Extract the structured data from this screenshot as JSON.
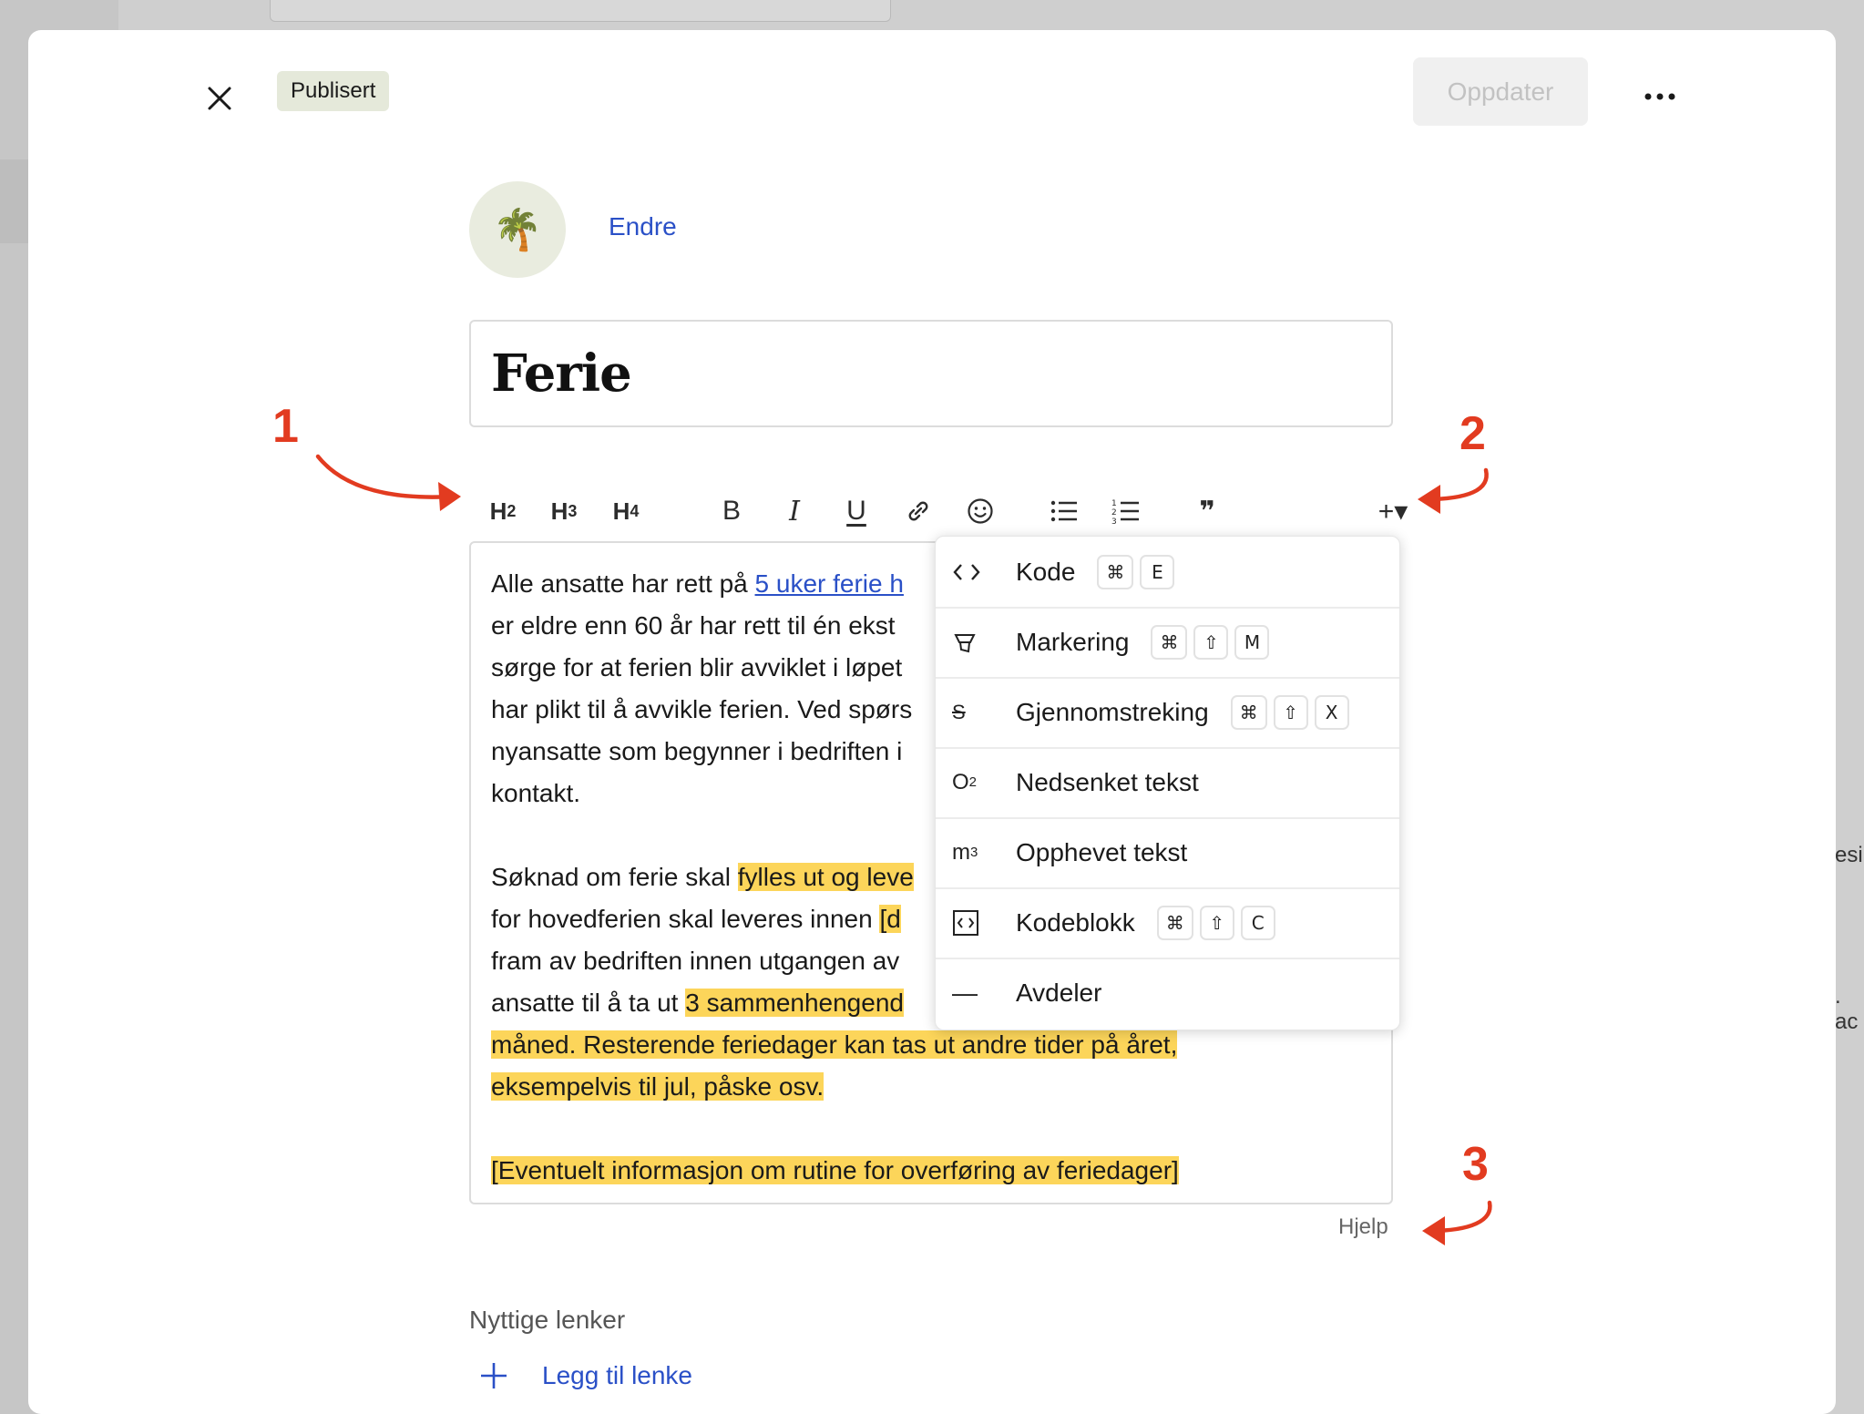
{
  "background": {
    "side_text_1": "esi",
    "side_text_2": ". ac"
  },
  "header": {
    "close_icon": "close-icon",
    "status_label": "Publisert",
    "update_label": "Oppdater",
    "more_icon": "more-horizontal-icon"
  },
  "avatar": {
    "emoji": "🌴",
    "change_label": "Endre"
  },
  "title": {
    "value": "Ferie"
  },
  "toolbar": {
    "h2": "H",
    "h2_sub": "2",
    "h3": "H",
    "h3_sub": "3",
    "h4": "H",
    "h4_sub": "4",
    "bold": "B",
    "italic": "I",
    "underline": "U",
    "link_icon": "link-icon",
    "emoji_icon": "smiley-icon",
    "bullet_icon": "bullet-list-icon",
    "numbered_icon": "numbered-list-icon",
    "quote": "❞",
    "insert": "+▾"
  },
  "editor": {
    "p1_before_link": "Alle ansatte har rett på ",
    "p1_link": "5 uker ferie h",
    "p1_lines": [
      "er eldre enn 60 år har rett til én ekst",
      "sørge for at ferien blir avviklet i løpet",
      "har plikt til å avvikle ferien. Ved spørs",
      "nyansatte som begynner i bedriften i",
      "kontakt."
    ],
    "p2_line1_plain": "Søknad om ferie skal ",
    "p2_line1_hl": "fylles ut og leve",
    "p2_line2_plain": "for hovedferien skal leveres innen ",
    "p2_line2_hl": "[d",
    "p2_line3_plain": "fram av bedriften innen utgangen av",
    "p2_line4_plain": "ansatte til å ta ut ",
    "p2_line4_hl": "3 sammenhengend",
    "p2_line5_hl": "måned. Resterende feriedager kan tas ut andre tider på året,",
    "p2_line6_hl": "eksempelvis til jul, påske osv.",
    "p3_hl": "[Eventuelt informasjon om rutine for overføring av feriedager]"
  },
  "dropdown": {
    "items": [
      {
        "label": "Kode",
        "icon": "code-icon",
        "keys": [
          "⌘",
          "E"
        ]
      },
      {
        "label": "Markering",
        "icon": "highlighter-icon",
        "keys": [
          "⌘",
          "⇧",
          "M"
        ]
      },
      {
        "label": "Gjennomstreking",
        "icon": "strikethrough-icon",
        "icon_text": "S",
        "keys": [
          "⌘",
          "⇧",
          "X"
        ]
      },
      {
        "label": "Nedsenket tekst",
        "icon": "subscript-icon",
        "icon_text": "O",
        "icon_sub": "2",
        "keys": []
      },
      {
        "label": "Opphevet tekst",
        "icon": "superscript-icon",
        "icon_text": "m",
        "icon_sup": "3",
        "keys": []
      },
      {
        "label": "Kodeblokk",
        "icon": "code-block-icon",
        "keys": [
          "⌘",
          "⇧",
          "C"
        ]
      },
      {
        "label": "Avdeler",
        "icon": "divider-icon",
        "icon_text": "—",
        "keys": []
      }
    ]
  },
  "help": {
    "label": "Hjelp"
  },
  "links": {
    "title": "Nyttige lenker",
    "add_label": "Legg til lenke",
    "add_icon": "plus-icon"
  },
  "annotations": {
    "n1": "1",
    "n2": "2",
    "n3": "3",
    "color": "#e23b20"
  },
  "colors": {
    "accent": "#2a50c7",
    "highlight": "#fcd55a",
    "badge_bg": "#e5e9da"
  }
}
